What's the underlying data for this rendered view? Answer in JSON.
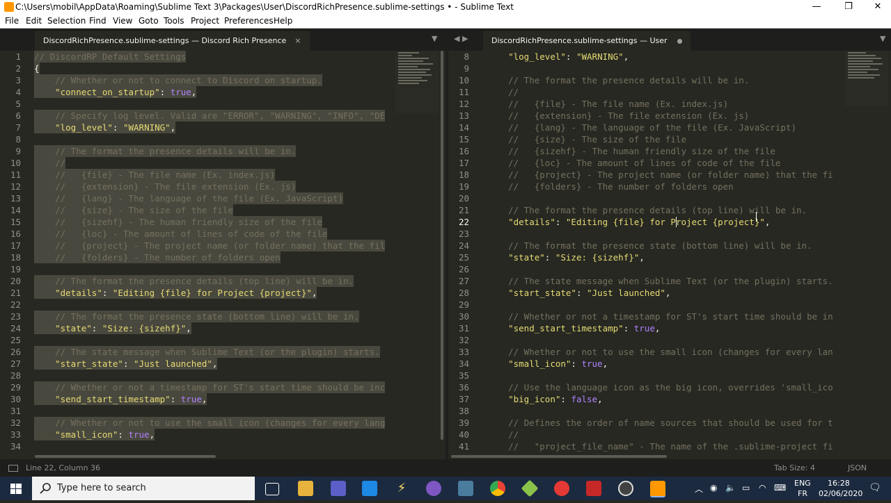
{
  "window": {
    "title": "C:\\Users\\mobil\\AppData\\Roaming\\Sublime Text 3\\Packages\\User\\DiscordRichPresence.sublime-settings • - Sublime Text",
    "controls": {
      "minimize": "—",
      "maximize": "❐",
      "close": "✕"
    }
  },
  "menu": [
    "File",
    "Edit",
    "Selection",
    "Find",
    "View",
    "Goto",
    "Tools",
    "Project",
    "Preferences",
    "Help"
  ],
  "left": {
    "tab": "DiscordRichPresence.sublime-settings — Discord Rich Presence",
    "close": "×",
    "lines": [
      {
        "n": "1",
        "t": "// DiscordRP Default Settings",
        "k": "c"
      },
      {
        "n": "2",
        "t": "{",
        "k": "p"
      },
      {
        "n": "3",
        "t": "    // Whether or not to connect to Discord on startup.",
        "k": "c"
      },
      {
        "n": "4",
        "t": "    \"connect_on_startup\": true,",
        "k": "kv",
        "key": "\"connect_on_startup\"",
        "val": "true",
        "vk": "num"
      },
      {
        "n": "5",
        "t": "",
        "k": "p"
      },
      {
        "n": "6",
        "t": "    // Specify log level. Valid are \"ERROR\", \"WARNING\", \"INFO\", \"DE",
        "k": "c"
      },
      {
        "n": "7",
        "t": "    \"log_level\": \"WARNING\",",
        "k": "kv",
        "key": "\"log_level\"",
        "val": "\"WARNING\"",
        "vk": "str"
      },
      {
        "n": "8",
        "t": "",
        "k": "p"
      },
      {
        "n": "9",
        "t": "    // The format the presence details will be in.",
        "k": "c"
      },
      {
        "n": "10",
        "t": "    //",
        "k": "c"
      },
      {
        "n": "11",
        "t": "    //   {file} - The file name (Ex. index.js)",
        "k": "c"
      },
      {
        "n": "12",
        "t": "    //   {extension} - The file extension (Ex. js)",
        "k": "c"
      },
      {
        "n": "13",
        "t": "    //   {lang} - The language of the file (Ex. JavaScript)",
        "k": "c"
      },
      {
        "n": "14",
        "t": "    //   {size} - The size of the file",
        "k": "c"
      },
      {
        "n": "15",
        "t": "    //   {sizehf} - The human friendly size of the file",
        "k": "c"
      },
      {
        "n": "16",
        "t": "    //   {loc} - The amount of lines of code of the file",
        "k": "c"
      },
      {
        "n": "17",
        "t": "    //   {project} - The project name (or folder name) that the fil",
        "k": "c"
      },
      {
        "n": "18",
        "t": "    //   {folders} - The number of folders open",
        "k": "c"
      },
      {
        "n": "19",
        "t": "",
        "k": "p"
      },
      {
        "n": "20",
        "t": "    // The format the presence details (top line) will be in.",
        "k": "c"
      },
      {
        "n": "21",
        "t": "    \"details\": \"Editing {file} for Project {project}\",",
        "k": "kv",
        "key": "\"details\"",
        "val": "\"Editing {file} for Project {project}\"",
        "vk": "str"
      },
      {
        "n": "22",
        "t": "",
        "k": "p"
      },
      {
        "n": "23",
        "t": "    // The format the presence state (bottom line) will be in.",
        "k": "c"
      },
      {
        "n": "24",
        "t": "    \"state\": \"Size: {sizehf}\",",
        "k": "kv",
        "key": "\"state\"",
        "val": "\"Size: {sizehf}\"",
        "vk": "str"
      },
      {
        "n": "25",
        "t": "",
        "k": "p"
      },
      {
        "n": "26",
        "t": "    // The state message when Sublime Text (or the plugin) starts.",
        "k": "c"
      },
      {
        "n": "27",
        "t": "    \"start_state\": \"Just launched\",",
        "k": "kv",
        "key": "\"start_state\"",
        "val": "\"Just launched\"",
        "vk": "str"
      },
      {
        "n": "28",
        "t": "",
        "k": "p"
      },
      {
        "n": "29",
        "t": "    // Whether or not a timestamp for ST's start time should be inc",
        "k": "c"
      },
      {
        "n": "30",
        "t": "    \"send_start_timestamp\": true,",
        "k": "kv",
        "key": "\"send_start_timestamp\"",
        "val": "true",
        "vk": "num"
      },
      {
        "n": "31",
        "t": "",
        "k": "p"
      },
      {
        "n": "32",
        "t": "    // Whether or not to use the small icon (changes for every lang",
        "k": "c"
      },
      {
        "n": "33",
        "t": "    \"small_icon\": true,",
        "k": "kv",
        "key": "\"small_icon\"",
        "val": "true",
        "vk": "num"
      },
      {
        "n": "34",
        "t": "",
        "k": "p"
      }
    ]
  },
  "right": {
    "tab": "DiscordRichPresence.sublime-settings — User",
    "lines": [
      {
        "n": "8",
        "t": "    \"log_level\": \"WARNING\",",
        "k": "kv",
        "key": "\"log_level\"",
        "val": "\"WARNING\"",
        "vk": "str"
      },
      {
        "n": "9",
        "t": "",
        "k": "p"
      },
      {
        "n": "10",
        "t": "    // The format the presence details will be in.",
        "k": "c"
      },
      {
        "n": "11",
        "t": "    //",
        "k": "c"
      },
      {
        "n": "12",
        "t": "    //   {file} - The file name (Ex. index.js)",
        "k": "c"
      },
      {
        "n": "13",
        "t": "    //   {extension} - The file extension (Ex. js)",
        "k": "c"
      },
      {
        "n": "14",
        "t": "    //   {lang} - The language of the file (Ex. JavaScript)",
        "k": "c"
      },
      {
        "n": "15",
        "t": "    //   {size} - The size of the file",
        "k": "c"
      },
      {
        "n": "16",
        "t": "    //   {sizehf} - The human friendly size of the file",
        "k": "c"
      },
      {
        "n": "17",
        "t": "    //   {loc} - The amount of lines of code of the file",
        "k": "c"
      },
      {
        "n": "18",
        "t": "    //   {project} - The project name (or folder name) that the fi",
        "k": "c"
      },
      {
        "n": "19",
        "t": "    //   {folders} - The number of folders open",
        "k": "c"
      },
      {
        "n": "20",
        "t": "",
        "k": "p"
      },
      {
        "n": "21",
        "t": "    // The format the presence details (top line) will be in.",
        "k": "c"
      },
      {
        "n": "22",
        "t": "    \"details\": \"Editing {file} for Project {project}\",",
        "k": "kv",
        "key": "\"details\"",
        "val": "\"Editing {file} for Project {project}\"",
        "vk": "str",
        "cur": true
      },
      {
        "n": "23",
        "t": "",
        "k": "p"
      },
      {
        "n": "24",
        "t": "    // The format the presence state (bottom line) will be in.",
        "k": "c"
      },
      {
        "n": "25",
        "t": "    \"state\": \"Size: {sizehf}\",",
        "k": "kv",
        "key": "\"state\"",
        "val": "\"Size: {sizehf}\"",
        "vk": "str"
      },
      {
        "n": "26",
        "t": "",
        "k": "p"
      },
      {
        "n": "27",
        "t": "    // The state message when Sublime Text (or the plugin) starts.",
        "k": "c"
      },
      {
        "n": "28",
        "t": "    \"start_state\": \"Just launched\",",
        "k": "kv",
        "key": "\"start_state\"",
        "val": "\"Just launched\"",
        "vk": "str"
      },
      {
        "n": "29",
        "t": "",
        "k": "p"
      },
      {
        "n": "30",
        "t": "    // Whether or not a timestamp for ST's start time should be in",
        "k": "c"
      },
      {
        "n": "31",
        "t": "    \"send_start_timestamp\": true,",
        "k": "kv",
        "key": "\"send_start_timestamp\"",
        "val": "true",
        "vk": "num"
      },
      {
        "n": "32",
        "t": "",
        "k": "p"
      },
      {
        "n": "33",
        "t": "    // Whether or not to use the small icon (changes for every lan",
        "k": "c"
      },
      {
        "n": "34",
        "t": "    \"small_icon\": true,",
        "k": "kv",
        "key": "\"small_icon\"",
        "val": "true",
        "vk": "num"
      },
      {
        "n": "35",
        "t": "",
        "k": "p"
      },
      {
        "n": "36",
        "t": "    // Use the language icon as the big icon, overrides 'small_ico",
        "k": "c"
      },
      {
        "n": "37",
        "t": "    \"big_icon\": false,",
        "k": "kv",
        "key": "\"big_icon\"",
        "val": "false",
        "vk": "num"
      },
      {
        "n": "38",
        "t": "",
        "k": "p"
      },
      {
        "n": "39",
        "t": "    // Defines the order of name sources that should be used for t",
        "k": "c"
      },
      {
        "n": "40",
        "t": "    //",
        "k": "c"
      },
      {
        "n": "41",
        "t": "    //   \"project_file_name\" - The name of the .sublime-project fi",
        "k": "c"
      }
    ]
  },
  "status": {
    "position": "Line 22, Column 36",
    "tab_size": "Tab Size: 4",
    "syntax": "JSON"
  },
  "taskbar": {
    "search_placeholder": "Type here to search",
    "lang": "ENG",
    "layout": "FR",
    "time": "16:28",
    "date": "02/06/2020"
  },
  "colors": {
    "comment": "#75715e",
    "string": "#e6db74",
    "constant": "#ae81ff",
    "bg": "#272822",
    "accent_taskbar": "#1c2a3f"
  }
}
